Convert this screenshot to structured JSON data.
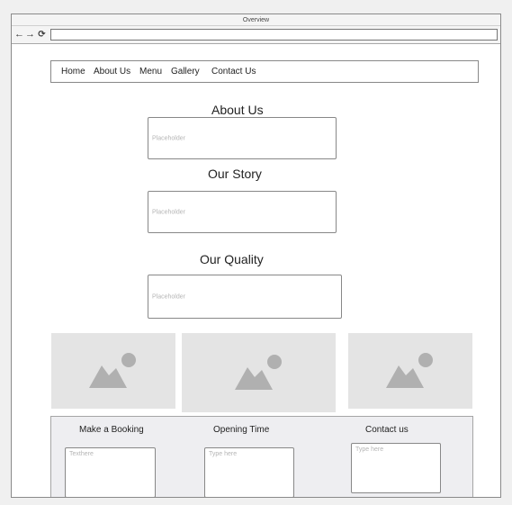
{
  "window": {
    "title": "Overview"
  },
  "toolbar": {
    "back_icon": "back-arrow-icon",
    "forward_icon": "forward-arrow-icon",
    "reload_icon": "reload-icon",
    "url_value": ""
  },
  "nav": {
    "items": [
      {
        "label": "Home"
      },
      {
        "label": "About Us"
      },
      {
        "label": "Menu"
      },
      {
        "label": "Gallery"
      },
      {
        "label": "Contact Us"
      }
    ]
  },
  "sections": [
    {
      "heading": "About Us",
      "placeholder": "Placeholder"
    },
    {
      "heading": "Our Story",
      "placeholder": "Placeholder"
    },
    {
      "heading": "Our Quality",
      "placeholder": "Placeholder"
    }
  ],
  "gallery": {
    "images": [
      {
        "icon": "image-placeholder-icon"
      },
      {
        "icon": "image-placeholder-icon"
      },
      {
        "icon": "image-placeholder-icon"
      }
    ]
  },
  "footer": {
    "columns": [
      {
        "heading": "Make a Booking",
        "placeholder": "Texthere"
      },
      {
        "heading": "Opening Time",
        "placeholder": "Type here"
      },
      {
        "heading": "Contact us",
        "placeholder": "Type here"
      }
    ]
  },
  "colors": {
    "image_tile": "#e4e4e4",
    "image_icon": "#b0b0b0",
    "footer_background": "#eeeef1",
    "placeholder_text": "#b5b5b5"
  }
}
